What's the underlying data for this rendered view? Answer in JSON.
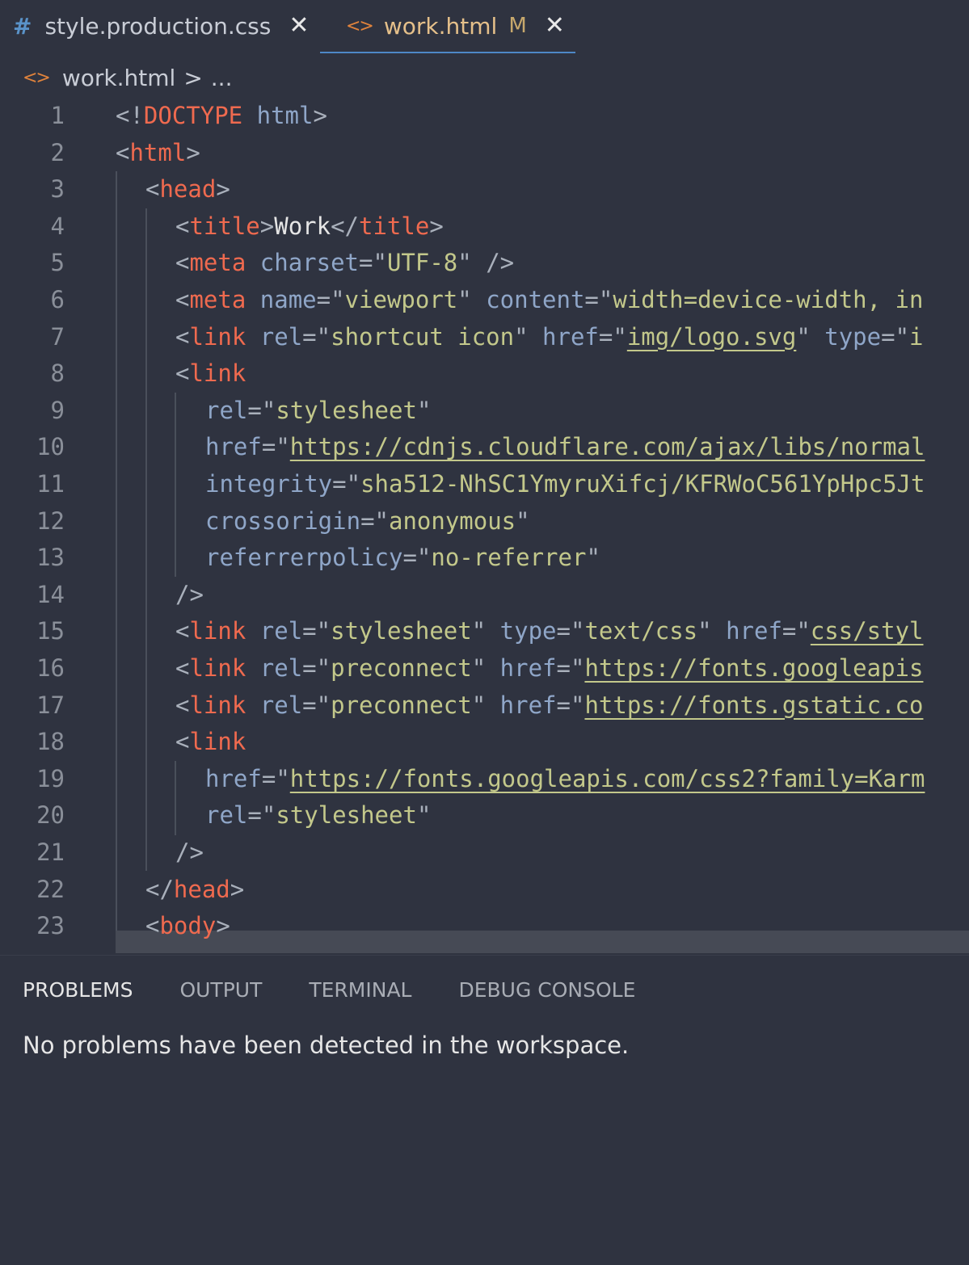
{
  "tabs": [
    {
      "icon": "hash-icon",
      "label": "style.production.css",
      "close": "✕"
    },
    {
      "icon": "code-icon",
      "label": "work.html",
      "modified": "M",
      "close": "✕"
    }
  ],
  "breadcrumb": {
    "file": "work.html",
    "separator": ">",
    "rest": "..."
  },
  "editor": {
    "line_numbers": [
      "1",
      "2",
      "3",
      "4",
      "5",
      "6",
      "7",
      "8",
      "9",
      "10",
      "11",
      "12",
      "13",
      "14",
      "15",
      "16",
      "17",
      "18",
      "19",
      "20",
      "21",
      "22",
      "23"
    ],
    "lines": [
      "<!DOCTYPE html>",
      "<html>",
      "  <head>",
      "    <title>Work</title>",
      "    <meta charset=\"UTF-8\" />",
      "    <meta name=\"viewport\" content=\"width=device-width, in",
      "    <link rel=\"shortcut icon\" href=\"img/logo.svg\" type=\"i",
      "    <link",
      "      rel=\"stylesheet\"",
      "      href=\"https://cdnjs.cloudflare.com/ajax/libs/normal",
      "      integrity=\"sha512-NhSC1YmyruXifcj/KFRWoC561YpHpc5Jt",
      "      crossorigin=\"anonymous\"",
      "      referrerpolicy=\"no-referrer\"",
      "    />",
      "    <link rel=\"stylesheet\" type=\"text/css\" href=\"css/styl",
      "    <link rel=\"preconnect\" href=\"https://fonts.googleapis",
      "    <link rel=\"preconnect\" href=\"https://fonts.gstatic.co",
      "    <link",
      "      href=\"https://fonts.googleapis.com/css2?family=Karm",
      "      rel=\"stylesheet\"",
      "    />",
      "  </head>",
      "  <body>"
    ]
  },
  "panel": {
    "tabs": [
      "PROBLEMS",
      "OUTPUT",
      "TERMINAL",
      "DEBUG CONSOLE"
    ],
    "active_tab": "PROBLEMS",
    "message": "No problems have been detected in the workspace."
  },
  "colors": {
    "background": "#2f3340",
    "tag": "#ef6a4f",
    "attribute": "#8fa6c8",
    "string": "#c3c88b",
    "punctuation": "#a9b0bb",
    "active_tab_border": "#4e88c7"
  }
}
